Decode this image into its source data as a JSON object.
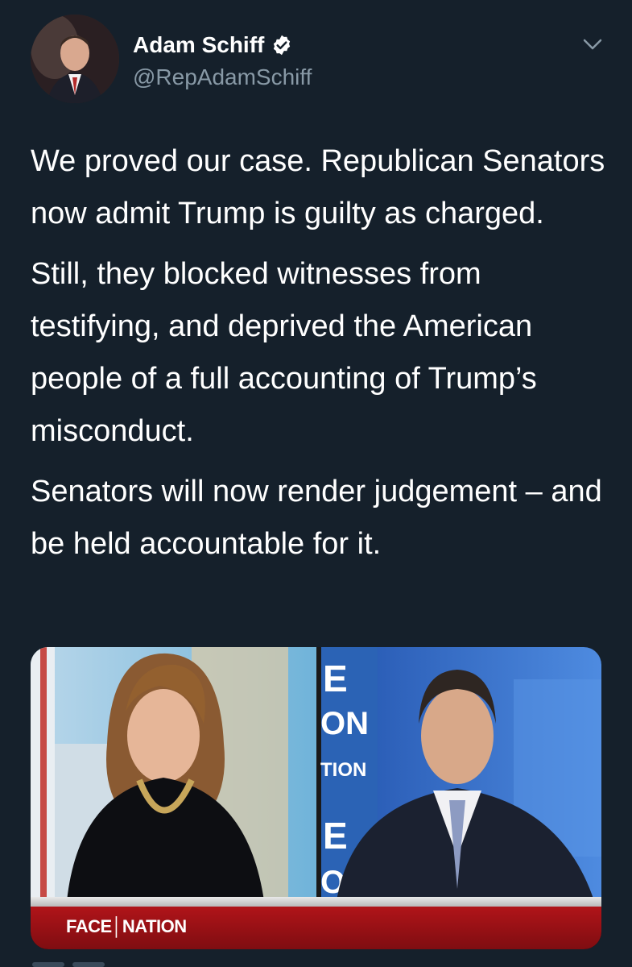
{
  "author": {
    "display_name": "Adam Schiff",
    "handle": "@RepAdamSchiff",
    "verified": true
  },
  "icons": {
    "verified": "verified-badge-icon",
    "menu": "chevron-down-icon"
  },
  "tweet": {
    "paragraphs": [
      "We proved our case. Republican Senators now admit Trump is guilty as charged.",
      "Still, they blocked witnesses from testifying, and deprived the American people of a full accounting of Trump’s misconduct.",
      "Senators will now render judgement – and be held accountable for it."
    ]
  },
  "media": {
    "type": "video-still",
    "lower_third_label": "FACE│NATION",
    "backdrop_text": [
      "E",
      "ON",
      "TION",
      "E",
      "O"
    ]
  },
  "colors": {
    "background": "#15202b",
    "secondary_text": "#8899a6",
    "verified_badge": "#ffffff",
    "lower_third": "#b01419"
  }
}
